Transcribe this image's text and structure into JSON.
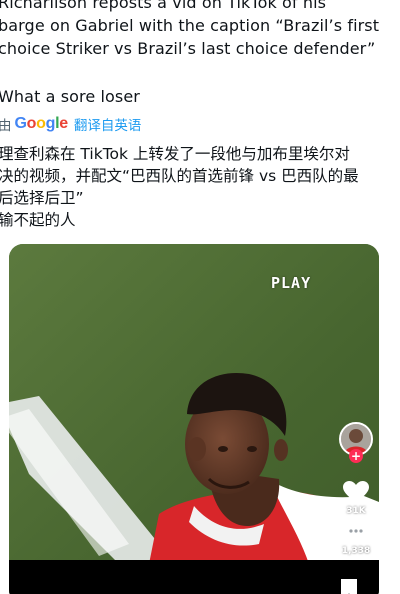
{
  "post": {
    "lines": [
      "Richarlison reposts a vid on TikTok of his",
      "barge on Gabriel with the caption “Brazil’s first",
      "choice Striker vs Brazil’s last choice defender”",
      "What a sore loser"
    ]
  },
  "translation": {
    "by_label": "由",
    "provider": "Google",
    "action_label": "翻译自英语",
    "lines": [
      "理查利森在 TikTok 上转发了一段他与加布里埃尔对",
      "决的视频，并配文“巴西队的首选前锋 vs 巴西队的最",
      "后选择后卫”",
      "输不起的人"
    ]
  },
  "video": {
    "play_label": "PLAY",
    "like_count": "31K",
    "comment_count": "1,338",
    "icons": [
      "avatar",
      "plus-icon",
      "heart-icon",
      "comment-icon",
      "bookmark-icon"
    ]
  },
  "colors": {
    "text": "#0f1419",
    "muted": "#536471",
    "link": "#1d9bf0",
    "follow": "#fe2c55",
    "jersey": "#d8262a"
  }
}
